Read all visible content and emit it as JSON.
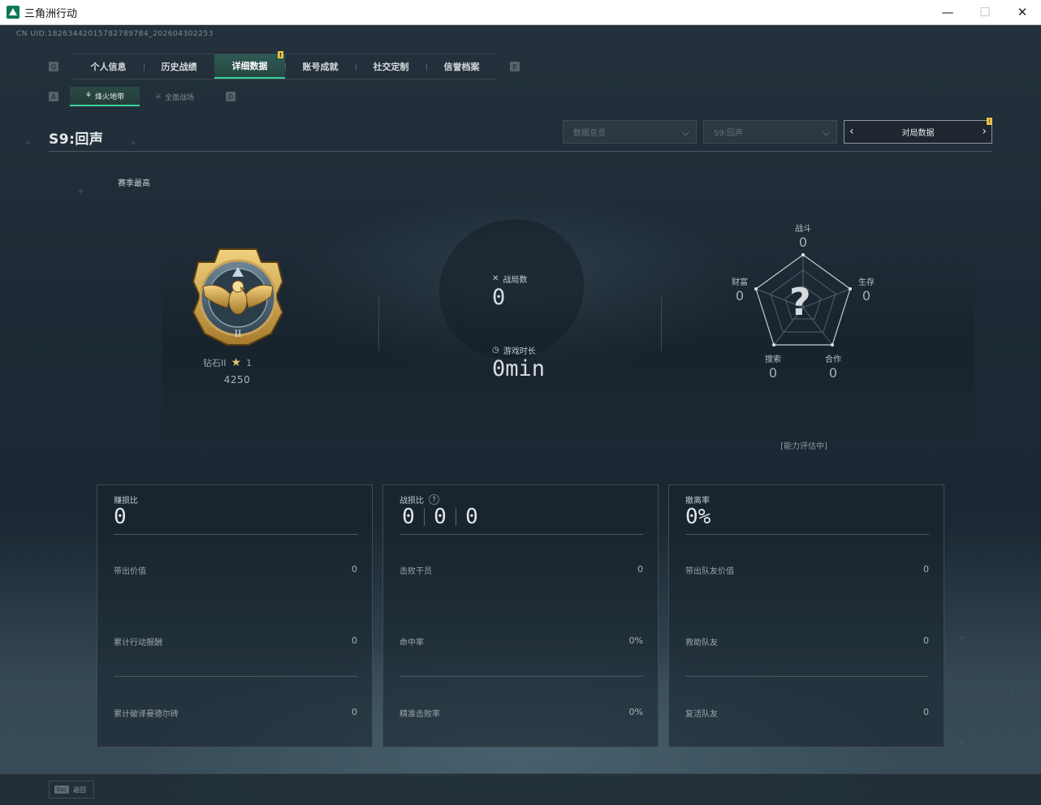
{
  "window": {
    "title": "三角洲行动",
    "minimize": "—",
    "maximize": "☐",
    "close": "✕"
  },
  "uid_text": "CN UID:18263442015782789784_202604302253",
  "tabs": {
    "left_key": "Q",
    "right_key": "E",
    "items": [
      {
        "label": "个人信息"
      },
      {
        "label": "历史战绩"
      },
      {
        "label": "详细数据",
        "badge": "!"
      },
      {
        "label": "账号成就"
      },
      {
        "label": "社交定制"
      },
      {
        "label": "信誉档案"
      }
    ]
  },
  "subtabs": {
    "left_key": "A",
    "right_key": "D",
    "items": [
      {
        "label": "烽火地带",
        "icon": "⚘"
      },
      {
        "label": "全面战场",
        "icon": "⚔"
      }
    ]
  },
  "season": {
    "title": "S9:回声",
    "dropdown_mode": "数据总览",
    "dropdown_season": "S9:回声",
    "stepper_label": "对局数据",
    "stepper_badge": "!",
    "left_arrow": "‹",
    "right_arrow": "›"
  },
  "best_label": "赛季最高",
  "rank": {
    "name": "钻石II",
    "stars": "1",
    "star_icon": "★",
    "score": "4250",
    "emblem_numeral": "II"
  },
  "center_stats": {
    "matches_label": "战局数",
    "matches_value": "0",
    "matches_icon": "✕",
    "playtime_label": "游戏时长",
    "playtime_value": "0min",
    "playtime_icon": "◷"
  },
  "radar": {
    "combat_label": "战斗",
    "combat_value": "0",
    "survival_label": "生存",
    "survival_value": "0",
    "coop_label": "合作",
    "coop_value": "0",
    "search_label": "搜索",
    "search_value": "0",
    "wealth_label": "财富",
    "wealth_value": "0",
    "unknown_mark": "?",
    "status": "[能力评估中]"
  },
  "cards": {
    "profit": {
      "label": "赚损比",
      "value": "0",
      "rows": [
        {
          "label": "带出价值",
          "value": "0"
        },
        {
          "label": "累计行动报酬",
          "value": "0"
        },
        {
          "label": "累计破译曼德尔砖",
          "value": "0"
        }
      ]
    },
    "kd": {
      "label": "战损比",
      "help": "?",
      "values": [
        "0",
        "0",
        "0"
      ],
      "rows": [
        {
          "label": "击败干员",
          "value": "0"
        },
        {
          "label": "命中率",
          "value": "0%"
        },
        {
          "label": "精准击败率",
          "value": "0%"
        }
      ]
    },
    "extract": {
      "label": "撤离率",
      "value": "0%",
      "rows": [
        {
          "label": "带出队友价值",
          "value": "0"
        },
        {
          "label": "救助队友",
          "value": "0"
        },
        {
          "label": "复活队友",
          "value": "0"
        }
      ]
    }
  },
  "bottom": {
    "esc_key": "Esc",
    "esc_label": "返回"
  }
}
